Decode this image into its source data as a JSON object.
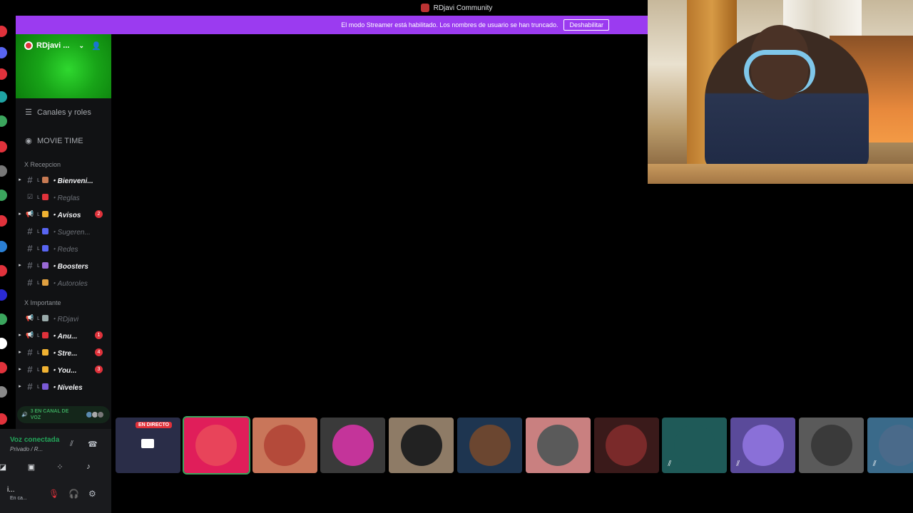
{
  "window": {
    "title": "RDjavi Community"
  },
  "banner": {
    "text": "El modo Streamer está habilitado. Los nombres de usuario se han truncado.",
    "button": "Deshabilitar"
  },
  "server": {
    "name": "RDjavi ..."
  },
  "nav": [
    {
      "label": "Canales y roles",
      "icon": "list-icon"
    },
    {
      "label": "MOVIE TIME",
      "icon": "broadcast-icon"
    }
  ],
  "categories": [
    {
      "label": "X Recepcion"
    },
    {
      "label": "X Importante"
    }
  ],
  "channels": [
    {
      "prefix": "ʟ",
      "label": "・Bienveni...",
      "bold": true,
      "icon": "hash",
      "emoji_color": "#c77a53",
      "count": ""
    },
    {
      "prefix": "ʟ",
      "label": "・Reglas",
      "bold": false,
      "icon": "rules",
      "emoji_color": "#e0323b",
      "count": ""
    },
    {
      "prefix": "ʟ",
      "label": "・Avisos",
      "bold": true,
      "icon": "megaphone",
      "emoji_color": "#f0b232",
      "count": "2"
    },
    {
      "prefix": "ʟ",
      "label": "・Sugeren...",
      "bold": false,
      "icon": "hash",
      "emoji_color": "#5865f2",
      "count": ""
    },
    {
      "prefix": "ʟ",
      "label": "・Redes",
      "bold": false,
      "icon": "hash",
      "emoji_color": "#5865f2",
      "count": ""
    },
    {
      "prefix": "ʟ",
      "label": "・Boosters",
      "bold": true,
      "icon": "hash",
      "emoji_color": "#9a6ad6",
      "count": ""
    },
    {
      "prefix": "ʟ",
      "label": "・Autoroles",
      "bold": false,
      "icon": "hash",
      "emoji_color": "#e0a040",
      "count": ""
    },
    {
      "prefix": "ʟ",
      "label": "・RDjavi",
      "bold": false,
      "icon": "megaphone",
      "emoji_color": "#9aa",
      "count": ""
    },
    {
      "prefix": "ʟ",
      "label": "・Anu...",
      "bold": true,
      "icon": "megaphone",
      "emoji_color": "#e0323b",
      "count": "1"
    },
    {
      "prefix": "ʟ",
      "label": "・Stre...",
      "bold": true,
      "icon": "hash",
      "emoji_color": "#f0b232",
      "count": "4"
    },
    {
      "prefix": "ʟ",
      "label": "・You...",
      "bold": true,
      "icon": "hash",
      "emoji_color": "#f0b232",
      "count": "3"
    },
    {
      "prefix": "ʟ",
      "label": "・Niveles",
      "bold": true,
      "icon": "hash",
      "emoji_color": "#7a5ad6",
      "count": ""
    }
  ],
  "voice_pill": {
    "label": "3 EN CANAL DE VOZ"
  },
  "voice_connection": {
    "status": "Voz conectada",
    "detail": "Privado / R..."
  },
  "user_panel": {
    "name": "i...",
    "status": "En ca..."
  },
  "participants": [
    {
      "live_label": "EN DIRECTO",
      "bg": "#2a2d48",
      "avatar": "#ffffff",
      "muted": false,
      "highlight": false
    },
    {
      "live_label": "",
      "bg": "#e01e5a",
      "avatar": "#e8445a",
      "muted": false,
      "highlight": true
    },
    {
      "live_label": "",
      "bg": "#c9765a",
      "avatar": "#b44a3a",
      "muted": false,
      "highlight": false
    },
    {
      "live_label": "",
      "bg": "#3a3a3a",
      "avatar": "#c4349a",
      "muted": false,
      "highlight": false
    },
    {
      "live_label": "",
      "bg": "#8e7b66",
      "avatar": "#222",
      "muted": false,
      "highlight": false
    },
    {
      "live_label": "",
      "bg": "#1e3550",
      "avatar": "#6b4630",
      "muted": false,
      "highlight": false
    },
    {
      "live_label": "",
      "bg": "#c98080",
      "avatar": "#5a5a5a",
      "muted": false,
      "highlight": false
    },
    {
      "live_label": "",
      "bg": "#3a1a1a",
      "avatar": "#7a2a2a",
      "muted": false,
      "highlight": false
    },
    {
      "live_label": "",
      "bg": "#1f5a58",
      "avatar": "#1f5a58",
      "muted": true,
      "highlight": false
    },
    {
      "live_label": "",
      "bg": "#5a4a9a",
      "avatar": "#8a70d8",
      "muted": true,
      "highlight": false
    },
    {
      "live_label": "",
      "bg": "#5a5a5a",
      "avatar": "#3a3a3a",
      "muted": false,
      "highlight": false
    },
    {
      "live_label": "",
      "bg": "#3a6a8a",
      "avatar": "#4a6a8a",
      "muted": true,
      "highlight": false
    }
  ]
}
